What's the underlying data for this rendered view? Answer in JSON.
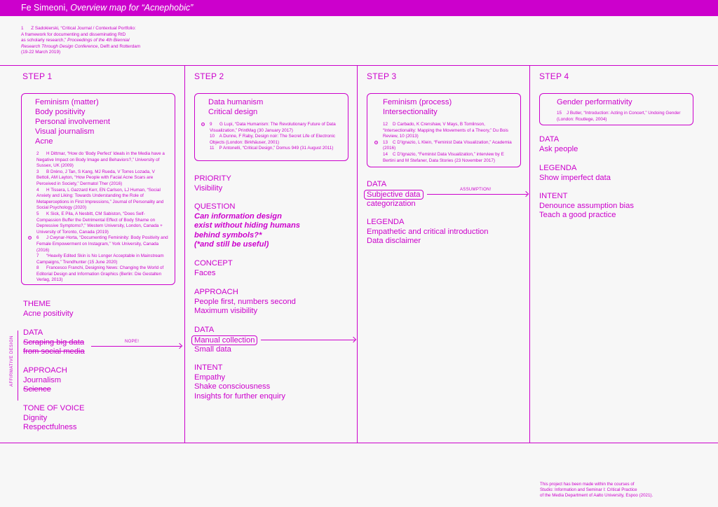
{
  "header": {
    "author": "Fe Simeoni,",
    "title": "Overview map for “Acnephobic”"
  },
  "top_ref": {
    "num": "1",
    "lines": [
      "Z Sadokierski, “Critical Journal / Contextual Portfolio:",
      "A framework for documenting and disseminating RtD",
      "as scholarly research,” ",
      "Research Through Design Conference",
      "(19-22 March 2019)"
    ],
    "italic1": "Proceedings of the 4th Biennial",
    "tail2": ", Delft and Rotterdam"
  },
  "steps": [
    "STEP 1",
    "STEP 2",
    "STEP 3",
    "STEP 4"
  ],
  "step1": {
    "box_title": [
      "Feminism (matter)",
      "Body positivity",
      "Personal involvement",
      "Visual journalism",
      "Acne"
    ],
    "refs": [
      {
        "n": "2",
        "t": "H Dittmar, “How do ‘Body Perfect’ Ideals in the Media have a Negative Impact on Body Image and Behaviors?,” University of Sussex, UK (2009)"
      },
      {
        "n": "3",
        "t": "B Dréno, J Tan, S Kang, MJ Rueda, V Torres Lozada, V Bettoli, AM Layton, “How People with Facial Acne Scars are Perceived in Society,” Dermatol Ther (2016)"
      },
      {
        "n": "4",
        "t": "H Tissera, L Gazzard Kerr, EN Carlson, LJ Human, “Social Anxiety and Liking: Towards Understanding the Role of Metaperceptions in First Impressions,” Journal of Personality and Social Psychology (2020)"
      },
      {
        "n": "5",
        "t": "K Sick, E Pila, A Nesbitt, CM Sabiston, “Does Self-Compassion Buffer the Detrimental Effect of Body Shame on Depressive Symptoms?,” Western University, London, Canada + University of Toronto, Canada (2019)"
      },
      {
        "n": "6",
        "t": "J Cwynar-Horta, “Documenting Femininity: Body Positivity and Female Empowerment on Instagram,” York University, Canada (2016)"
      },
      {
        "n": "7",
        "t": "“Heavily Edited Skin is No Longer Acceptable in Mainstream Campaigns,” Trendhunter (15 June 2020)"
      },
      {
        "n": "8",
        "t": "Francesco Franchi, Designing News: Changing the World of Editorial Design and Information Graphics (Berlin: Die Gestalten Verlag, 2013)"
      }
    ],
    "theme_h": "THEME",
    "theme_v": "Acne positivity",
    "data_h": "DATA",
    "data_v1": "Scraping big data",
    "data_v2": "from social media",
    "approach_h": "APPROACH",
    "approach_v1": "Journalism",
    "approach_v2": "Science",
    "tone_h": "TONE OF VOICE",
    "tone_v1": "Dignity",
    "tone_v2": "Respectfulness",
    "nope": "NOPE!",
    "affirmative": "AFFIRMATIVE DESIGN"
  },
  "step2": {
    "box_title": [
      "Data humanism",
      "Critical design"
    ],
    "refs": [
      {
        "n": "9",
        "t": "G Lupi, “Data Humanism: The Revolutionary Future of Data Visualization,” PrintMag (30 January 2017)"
      },
      {
        "n": "10",
        "t": "A Dunne, F Raby, Design noir: The Secret Life of Electronic Objects (London: Birkhäuser, 2001)"
      },
      {
        "n": "11",
        "t": "P Antonelli, “Critical Design,” Domus 949 (31 August 2011)"
      }
    ],
    "priority_h": "PRIORITY",
    "priority_v": "Visibility",
    "question_h": "QUESTION",
    "question_v": [
      "Can information design",
      "exist without hiding humans",
      "behind symbols?*",
      "(*and still be useful)"
    ],
    "concept_h": "CONCEPT",
    "concept_v": "Faces",
    "approach_h": "APPROACH",
    "approach_v1": "People first, numbers second",
    "approach_v2": "Maximum visibility",
    "data_h": "DATA",
    "data_v1": "Manual collection",
    "data_v2": "Small data",
    "intent_h": "INTENT",
    "intent_v1": "Empathy",
    "intent_v2": "Shake consciousness",
    "intent_v3": "Insights for further enquiry"
  },
  "step3": {
    "box_title": [
      "Feminism (process)",
      "Intersectionality"
    ],
    "refs": [
      {
        "n": "12",
        "t": "D Carbado, K Crenshaw, V Mays, B Tomlinson, “Intersectionality: Mapping the Movements of a Theory,” Du Bois Review, 10 (2013)"
      },
      {
        "n": "13",
        "t": "C D’Ignazio, L Klein, “Feminist Data Visualization,” Academia (2016)"
      },
      {
        "n": "14",
        "t": "C D’Ignazio, “Feminist Data Visualization,” interview by E Bertini and M Stefaner, Data Stories (23 November 2017)"
      }
    ],
    "data_h": "DATA",
    "data_v1": "Subjective data",
    "data_v2": "categorization",
    "assumption": "ASSUMPTION!",
    "legenda_h": "LEGENDA",
    "legenda_v1": "Empathetic and critical introduction",
    "legenda_v2": "Data disclaimer"
  },
  "step4": {
    "box_title": [
      "Gender performativity"
    ],
    "refs": [
      {
        "n": "15",
        "t": "J Butler, “Introduction: Acting in Concert,” Undoing Gender (London: Routlege, 2004)"
      }
    ],
    "data_h": "DATA",
    "data_v": "Ask people",
    "legenda_h": "LEGENDA",
    "legenda_v": "Show imperfect data",
    "intent_h": "INTENT",
    "intent_v1": "Denounce assumption bias",
    "intent_v2": "Teach a good practice"
  },
  "footer": [
    "This project has been made within the courses of",
    "Studio: Information and Seminar I: Critical Practice",
    "of the Media Department of Aalto University, Espoo (2021)."
  ]
}
